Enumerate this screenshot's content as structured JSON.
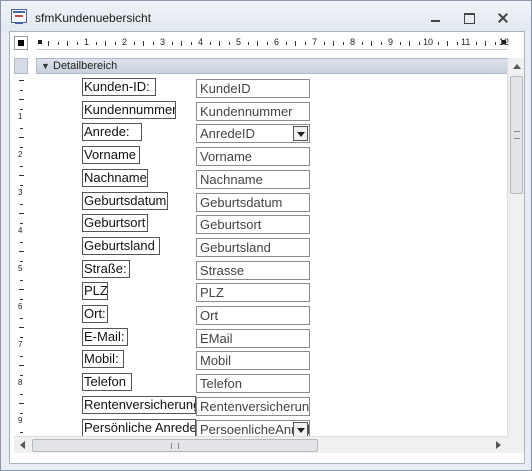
{
  "window": {
    "title": "sfmKundenuebersicht"
  },
  "ruler": {
    "numbers": [
      "1",
      "2",
      "3",
      "4",
      "5",
      "6",
      "7",
      "8",
      "9",
      "10",
      "11",
      "12"
    ],
    "left_numbers": [
      "1",
      "2",
      "3",
      "4",
      "5",
      "6",
      "7",
      "8",
      "9"
    ]
  },
  "section": {
    "label": "Detailbereich"
  },
  "form": {
    "rows": [
      {
        "label": "Kunden-ID:",
        "field": "KundeID",
        "combo": false
      },
      {
        "label": "Kundennummer",
        "field": "Kundennummer",
        "combo": false
      },
      {
        "label": "Anrede:",
        "field": "AnredeID",
        "combo": true
      },
      {
        "label": "Vorname",
        "field": "Vorname",
        "combo": false
      },
      {
        "label": "Nachname",
        "field": "Nachname",
        "combo": false
      },
      {
        "label": "Geburtsdatum",
        "field": "Geburtsdatum",
        "combo": false
      },
      {
        "label": "Geburtsort",
        "field": "Geburtsort",
        "combo": false
      },
      {
        "label": "Geburtsland",
        "field": "Geburtsland",
        "combo": false
      },
      {
        "label": "Straße:",
        "field": "Strasse",
        "combo": false
      },
      {
        "label": "PLZ:",
        "field": "PLZ",
        "combo": false
      },
      {
        "label": "Ort:",
        "field": "Ort",
        "combo": false
      },
      {
        "label": "E-Mail:",
        "field": "EMail",
        "combo": false
      },
      {
        "label": "Mobil:",
        "field": "Mobil",
        "combo": false
      },
      {
        "label": "Telefon",
        "field": "Telefon",
        "combo": false
      },
      {
        "label": "Rentenversicherungsnummer",
        "field": "Rentenversicherungsnummer",
        "combo": false
      },
      {
        "label": "Persönliche Anrede",
        "field": "PersoenlicheAnrede",
        "combo": true
      }
    ]
  }
}
